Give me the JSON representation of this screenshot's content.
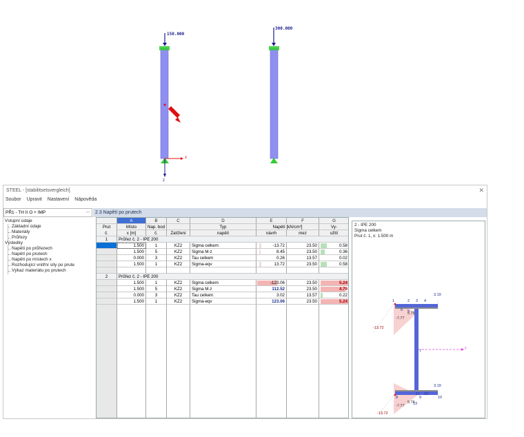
{
  "model": {
    "load_left": "150.000",
    "load_right": "300.000",
    "axis_x": "x",
    "axis_z": "z"
  },
  "window": {
    "title": "STEEL - [stabilitsetsvergleich]",
    "close": "✕"
  },
  "menu": [
    "Soubor",
    "Upravit",
    "Nastavení",
    "Nápověda"
  ],
  "case_select": {
    "value": "PŘ1 - TH II O + IMP"
  },
  "pane_title": "2.3 Napětí po prutech",
  "tree": {
    "input_group": "Vstupní údaje",
    "input_items": [
      "Základní údaje",
      "Materiály",
      "Průřezy"
    ],
    "results_group": "Výsledky",
    "results_items": [
      "Napětí po průřezech",
      "Napětí po prutech",
      "Napětí po místech x",
      "Rozhodující vnitřní síly po prute",
      "Výkaz materiálu po prutech"
    ]
  },
  "table": {
    "letters": [
      "A",
      "B",
      "C",
      "D",
      "E",
      "F",
      "G"
    ],
    "header1": [
      "Prut",
      "Místo",
      "Nap. bod",
      "",
      "Typ",
      "Napětí [kN/cm²]",
      "",
      "Vy-"
    ],
    "header2": [
      "č.",
      "x [m]",
      "č.",
      "Zatížení",
      "napětí",
      "návrh",
      "mez",
      "užití"
    ],
    "groups": [
      {
        "member": "1",
        "label": "Průřez č. 2 - IPE 200",
        "rows": [
          {
            "x": "1.500",
            "pt": "1",
            "load": "KZ2",
            "type": "Sigma celkem",
            "design": "-13.72",
            "limit": "23.50",
            "ratio": "0.58"
          },
          {
            "x": "1.500",
            "pt": "5",
            "load": "KZ2",
            "type": "Sigma M-z",
            "design": "8.45",
            "limit": "23.50",
            "ratio": "0.36"
          },
          {
            "x": "0.000",
            "pt": "3",
            "load": "KZ2",
            "type": "Tau celkem",
            "design": "0.26",
            "limit": "13.57",
            "ratio": "0.02"
          },
          {
            "x": "1.500",
            "pt": "1",
            "load": "KZ2",
            "type": "Sigma-eqv",
            "design": "13.72",
            "limit": "23.50",
            "ratio": "0.58"
          }
        ]
      },
      {
        "member": "2",
        "label": "Průřez č. 2 - IPE 200",
        "rows": [
          {
            "x": "1.500",
            "pt": "1",
            "load": "KZ2",
            "type": "Sigma celkem",
            "design": "-123.06",
            "limit": "23.50",
            "ratio": "5.24"
          },
          {
            "x": "1.500",
            "pt": "5",
            "load": "KZ2",
            "type": "Sigma M-z",
            "design": "112.52",
            "limit": "23.50",
            "ratio": "4.79"
          },
          {
            "x": "0.000",
            "pt": "3",
            "load": "KZ2",
            "type": "Tau celkem",
            "design": "3.02",
            "limit": "13.57",
            "ratio": "0.22"
          },
          {
            "x": "1.500",
            "pt": "1",
            "load": "KZ2",
            "type": "Sigma-eqv",
            "design": "123.06",
            "limit": "23.50",
            "ratio": "5.24"
          }
        ]
      }
    ]
  },
  "preview": {
    "line1": "2 - IPE 200",
    "line2": "Sigma celkem",
    "line3": "Prut č. 1, x: 1.500 m",
    "val_left_top": "-13.72",
    "val_right_top": "3.19",
    "val_mid_a": "-7.77",
    "val_mid_b": "5.76",
    "val_right_bot": "3.19",
    "val_left_bot": "-13.72",
    "val_bot_a": "-7.77",
    "val_bot_b": "5.76",
    "axis_y": "y",
    "pts": [
      "1",
      "2",
      "3",
      "4",
      "5",
      "6",
      "7",
      "8",
      "9",
      "10",
      "11",
      "12",
      "13"
    ]
  },
  "colors": {
    "member": "#8f8ff0",
    "load_arrow": "#1a1a8c",
    "support": "#2fc02f",
    "pointer": "#e01010",
    "accent_table": "#3f6fd4"
  }
}
